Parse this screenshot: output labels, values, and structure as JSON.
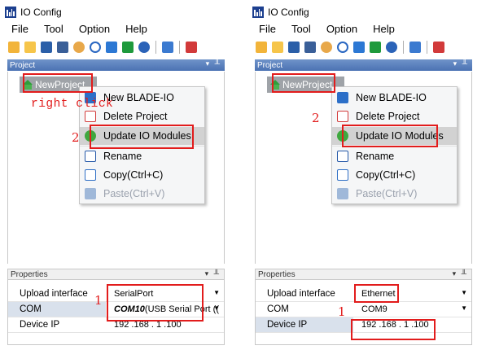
{
  "window": {
    "title": "IO Config"
  },
  "menubar": [
    "File",
    "Tool",
    "Option",
    "Help"
  ],
  "toolbar_icons": [
    "open-folder-icon",
    "folder-icon",
    "save-icon",
    "save-as-icon",
    "settings-icon",
    "search-icon",
    "download-icon",
    "record-icon",
    "help-icon",
    "grid-icon",
    "delete-icon"
  ],
  "project_panel": {
    "header": "Project",
    "pin": "▾ ╨",
    "node": "NewProject"
  },
  "context_menu": {
    "items": [
      {
        "label": "New BLADE-IO",
        "icon": "blade-io-icon"
      },
      {
        "label": "Delete Project",
        "icon": "trash-icon"
      },
      {
        "label": "Update IO Modules",
        "icon": "refresh-icon"
      },
      {
        "label": "Rename",
        "icon": "rename-icon"
      },
      {
        "label": "Copy(Ctrl+C)",
        "icon": "copy-icon"
      },
      {
        "label": "Paste(Ctrl+V)",
        "icon": "paste-icon"
      }
    ]
  },
  "properties_panel": {
    "header": "Properties",
    "pin": "▾ ╨"
  },
  "left_properties": [
    {
      "name": "Upload interface",
      "value": "SerialPort"
    },
    {
      "name": "COM",
      "value": "COM10",
      "value_suffix": " (USB Serial Port (("
    },
    {
      "name": "Device IP",
      "value": "192 .168 . 1  .100"
    }
  ],
  "right_properties": [
    {
      "name": "Upload interface",
      "value": "Ethernet"
    },
    {
      "name": "COM",
      "value": "COM9"
    },
    {
      "name": "Device IP",
      "value": "192 .168 . 1  .100"
    }
  ],
  "annotations": {
    "right_click": "right click",
    "step_1": "1",
    "step_2": "2"
  },
  "colors": {
    "annotation_red": "#e21c1c",
    "panel_header_blue": "#5a80c0",
    "tree_node_gray": "#9fa3a8",
    "hover_gray": "#d2d2d2"
  }
}
